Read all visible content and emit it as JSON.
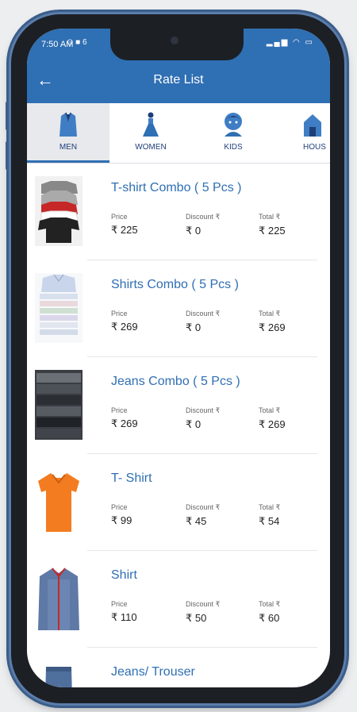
{
  "status": {
    "time": "7:50 AM",
    "icons_left": "⊙ ■ 6"
  },
  "header": {
    "title": "Rate List"
  },
  "tabs": [
    {
      "label": "MEN"
    },
    {
      "label": "WOMEN"
    },
    {
      "label": "KIDS"
    },
    {
      "label": "HOUS"
    }
  ],
  "column_labels": {
    "price": "Price",
    "discount": "Discount ₹",
    "total": "Total ₹"
  },
  "items": [
    {
      "name": "T-shirt Combo ( 5 Pcs )",
      "price": "₹ 225",
      "discount": "₹ 0",
      "total": "₹ 225"
    },
    {
      "name": "Shirts Combo ( 5 Pcs )",
      "price": "₹ 269",
      "discount": "₹ 0",
      "total": "₹ 269"
    },
    {
      "name": "Jeans Combo ( 5 Pcs )",
      "price": "₹ 269",
      "discount": "₹ 0",
      "total": "₹ 269"
    },
    {
      "name": "T- Shirt",
      "price": "₹ 99",
      "discount": "₹ 45",
      "total": "₹ 54"
    },
    {
      "name": "Shirt",
      "price": "₹ 110",
      "discount": "₹ 50",
      "total": "₹ 60"
    },
    {
      "name": "Jeans/ Trouser",
      "price": "",
      "discount": "",
      "total": ""
    }
  ],
  "colors": {
    "primary": "#2f6fb3",
    "tab_text": "#1f3e78",
    "orange": "#f47c20"
  }
}
